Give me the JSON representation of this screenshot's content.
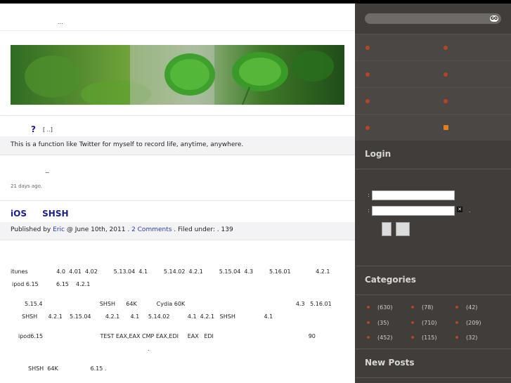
{
  "header": {
    "ellipsis": "..."
  },
  "post1": {
    "title": "?",
    "meta": "[ ..]",
    "description": "This is a function like Twitter for myself to record life, anytime, anywhere."
  },
  "tweet": {
    "text": "~",
    "time": "21 days ago."
  },
  "post2": {
    "title": "iOS SHSH",
    "published_by": "Published by",
    "author": "Eric",
    "date": "@ June 10th, 2011 .",
    "comments": "2 Comments",
    "filed": ". Filed under:",
    "count": ". 139"
  },
  "content_lines": [
    "itunes                4.0  4.01  4.02         5.13.04  4.1         5.14.02  4.2.1         5.15.04  4.3         5.16.01              4.2.1",
    "ipod 6.15          6.15    4.2.1",
    "5.15.4                                SHSH      64K           Cydia 60K                                                              4.3   5.16.01",
    "SHSH      4.2.1    5.15.04        4.2.1      4.1     5.14.02          4.1  4.2.1   SHSH                4.1",
    "ipod6.15                                TEST EAX,EAX CMP EAX,EDI     EAX   EDI                                                     90",
    ".",
    "SHSH  64K                  6.15 ."
  ],
  "sidebar": {
    "search": {
      "button": "GO"
    },
    "login": {
      "heading": "Login",
      "user_label": ":",
      "pass_label": ":",
      "dot": "."
    },
    "categories": {
      "heading": "Categories",
      "items": [
        "(630)",
        "(78)",
        "(42)",
        "(35)",
        "(710)",
        "(209)",
        "(452)",
        "(115)",
        "(32)"
      ]
    },
    "new_posts": {
      "heading": "New Posts"
    }
  },
  "colors": {
    "sidebar_bg": "#403d3b",
    "link": "#1d1d8a",
    "bullet": "#b8451e",
    "rss": "#e87d1f"
  }
}
